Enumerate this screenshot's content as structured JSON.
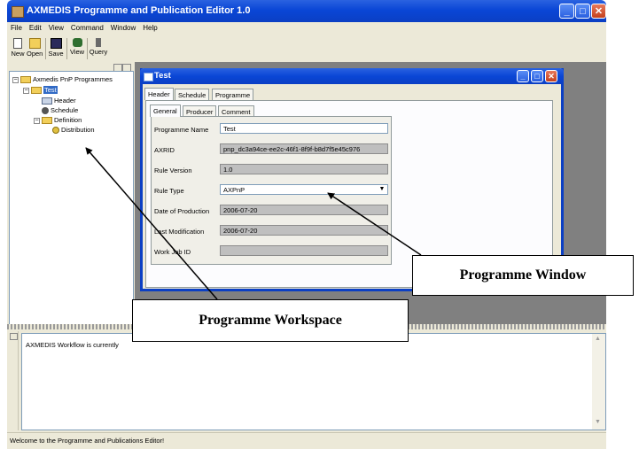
{
  "window": {
    "title": "AXMEDIS Programme and Publication Editor 1.0",
    "minimize": "_",
    "maximize": "□",
    "close": "✕"
  },
  "menu": [
    "File",
    "Edit",
    "View",
    "Command",
    "Window",
    "Help"
  ],
  "toolbar": {
    "new_label": "New",
    "open_label": "Open",
    "save_label": "Save",
    "view_label": "View",
    "query_label": "Query"
  },
  "tree": {
    "root": "Axmedis PnP Programmes",
    "programme": "Test",
    "header": "Header",
    "schedule": "Schedule",
    "definition": "Definition",
    "distribution": "Distribution"
  },
  "child_window": {
    "title": "Test",
    "tabs": [
      "Header",
      "Schedule",
      "Programme"
    ],
    "subtabs": [
      "General",
      "Producer",
      "Comment"
    ],
    "fields": [
      {
        "label": "Programme Name",
        "value": "Test"
      },
      {
        "label": "AXRID",
        "value": "pnp_dc3a94ce-ee2c-46f1-8f9f-b8d7f5e45c976"
      },
      {
        "label": "Rule Version",
        "value": "1.0"
      },
      {
        "label": "Rule Type",
        "value": "AXPnP"
      },
      {
        "label": "Date of Production",
        "value": "2006-07-20"
      },
      {
        "label": "Last Modification",
        "value": "2006-07-20"
      },
      {
        "label": "Work Job ID",
        "value": ""
      }
    ]
  },
  "output": {
    "message": "AXMEDIS Workflow is currently"
  },
  "status": "Welcome to the Programme and Publications Editor!",
  "callouts": {
    "window": "Programme Window",
    "workspace": "Programme Workspace"
  },
  "colors": {
    "titlebar": "#0b3fc4",
    "face": "#ece9d8",
    "selection": "#316ac5"
  }
}
